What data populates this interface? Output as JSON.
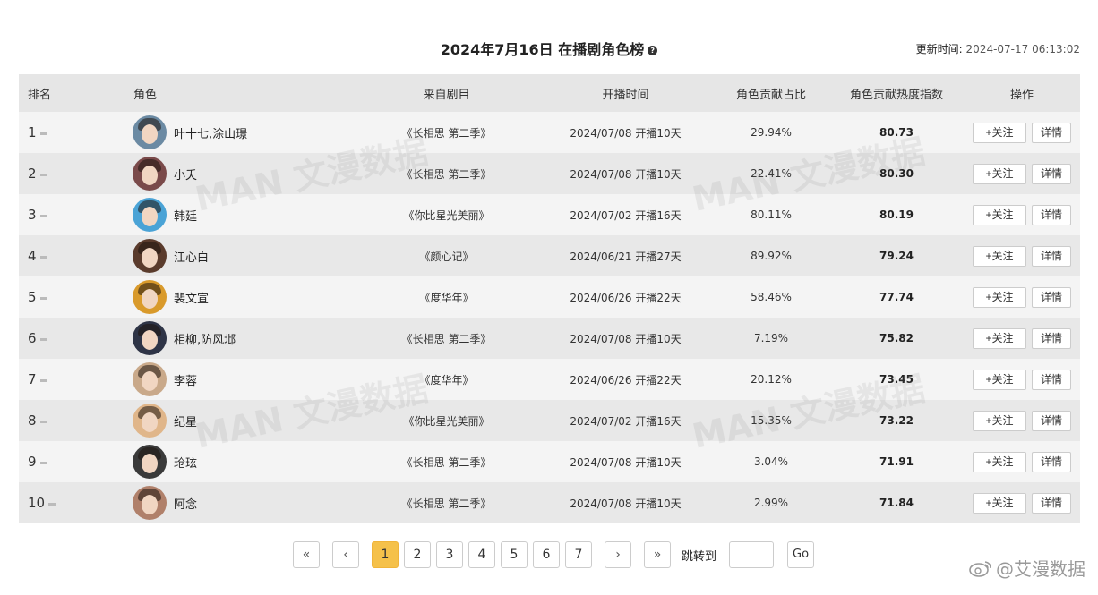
{
  "header": {
    "title": "2024年7月16日 在播剧角色榜",
    "help_icon": "?",
    "update_label": "更新时间:",
    "update_value": "2024-07-17 06:13:02"
  },
  "columns": [
    "排名",
    "角色",
    "来自剧目",
    "开播时间",
    "角色贡献占比",
    "角色贡献热度指数",
    "操作"
  ],
  "rows": [
    {
      "rank": "1",
      "role": "叶十七,涂山璟",
      "drama": "《长相思 第二季》",
      "date": "2024/07/08",
      "days": "开播10天",
      "ratio": "29.94%",
      "score": "80.73",
      "avatar_color": "#6b8aa3"
    },
    {
      "rank": "2",
      "role": "小夭",
      "drama": "《长相思 第二季》",
      "date": "2024/07/08",
      "days": "开播10天",
      "ratio": "22.41%",
      "score": "80.30",
      "avatar_color": "#7a4a4a"
    },
    {
      "rank": "3",
      "role": "韩廷",
      "drama": "《你比星光美丽》",
      "date": "2024/07/02",
      "days": "开播16天",
      "ratio": "80.11%",
      "score": "80.19",
      "avatar_color": "#4aa3d6"
    },
    {
      "rank": "4",
      "role": "江心白",
      "drama": "《颜心记》",
      "date": "2024/06/21",
      "days": "开播27天",
      "ratio": "89.92%",
      "score": "79.24",
      "avatar_color": "#5a3b2c"
    },
    {
      "rank": "5",
      "role": "裴文宣",
      "drama": "《度华年》",
      "date": "2024/06/26",
      "days": "开播22天",
      "ratio": "58.46%",
      "score": "77.74",
      "avatar_color": "#d99a2b"
    },
    {
      "rank": "6",
      "role": "相柳,防风邶",
      "drama": "《长相思 第二季》",
      "date": "2024/07/08",
      "days": "开播10天",
      "ratio": "7.19%",
      "score": "75.82",
      "avatar_color": "#2e3446"
    },
    {
      "rank": "7",
      "role": "李蓉",
      "drama": "《度华年》",
      "date": "2024/06/26",
      "days": "开播22天",
      "ratio": "20.12%",
      "score": "73.45",
      "avatar_color": "#c9a98a"
    },
    {
      "rank": "8",
      "role": "纪星",
      "drama": "《你比星光美丽》",
      "date": "2024/07/02",
      "days": "开播16天",
      "ratio": "15.35%",
      "score": "73.22",
      "avatar_color": "#e0b68a"
    },
    {
      "rank": "9",
      "role": "玱玹",
      "drama": "《长相思 第二季》",
      "date": "2024/07/08",
      "days": "开播10天",
      "ratio": "3.04%",
      "score": "71.91",
      "avatar_color": "#3a3a3a"
    },
    {
      "rank": "10",
      "role": "阿念",
      "drama": "《长相思 第二季》",
      "date": "2024/07/08",
      "days": "开播10天",
      "ratio": "2.99%",
      "score": "71.84",
      "avatar_color": "#b0806a"
    }
  ],
  "actions": {
    "follow": "+关注",
    "detail": "详情"
  },
  "pagination": {
    "first": "«",
    "prev": "‹",
    "pages": [
      "1",
      "2",
      "3",
      "4",
      "5",
      "6",
      "7"
    ],
    "active": "1",
    "next": "›",
    "last": "»",
    "jump_label": "跳转到",
    "go": "Go"
  },
  "watermark": "MAN 文漫数据",
  "brand": "@艾漫数据",
  "colors": {
    "accent": "#f5c14a",
    "header_bg": "#e6e6e6",
    "row_odd": "#f4f4f4",
    "row_even": "#e8e8e8"
  }
}
